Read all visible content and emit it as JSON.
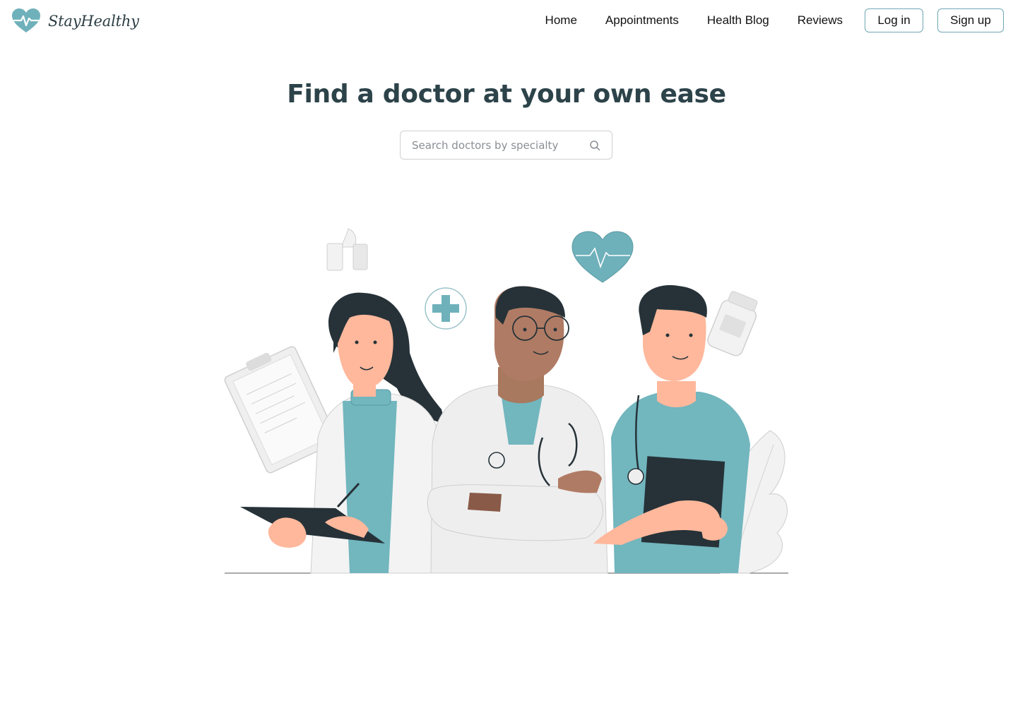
{
  "brand": {
    "name": "StayHealthy",
    "icon": "heart-pulse-icon",
    "color": "#6fb1bb"
  },
  "nav": {
    "links": [
      "Home",
      "Appointments",
      "Health Blog",
      "Reviews"
    ],
    "login_label": "Log in",
    "signup_label": "Sign up"
  },
  "hero": {
    "title": "Find a doctor at your own ease"
  },
  "search": {
    "placeholder": "Search doctors by specialty",
    "value": "",
    "icon": "search-icon"
  },
  "colors": {
    "accent": "#6fb1bb",
    "heading": "#2d434a",
    "button_border": "#6fa8b3"
  }
}
